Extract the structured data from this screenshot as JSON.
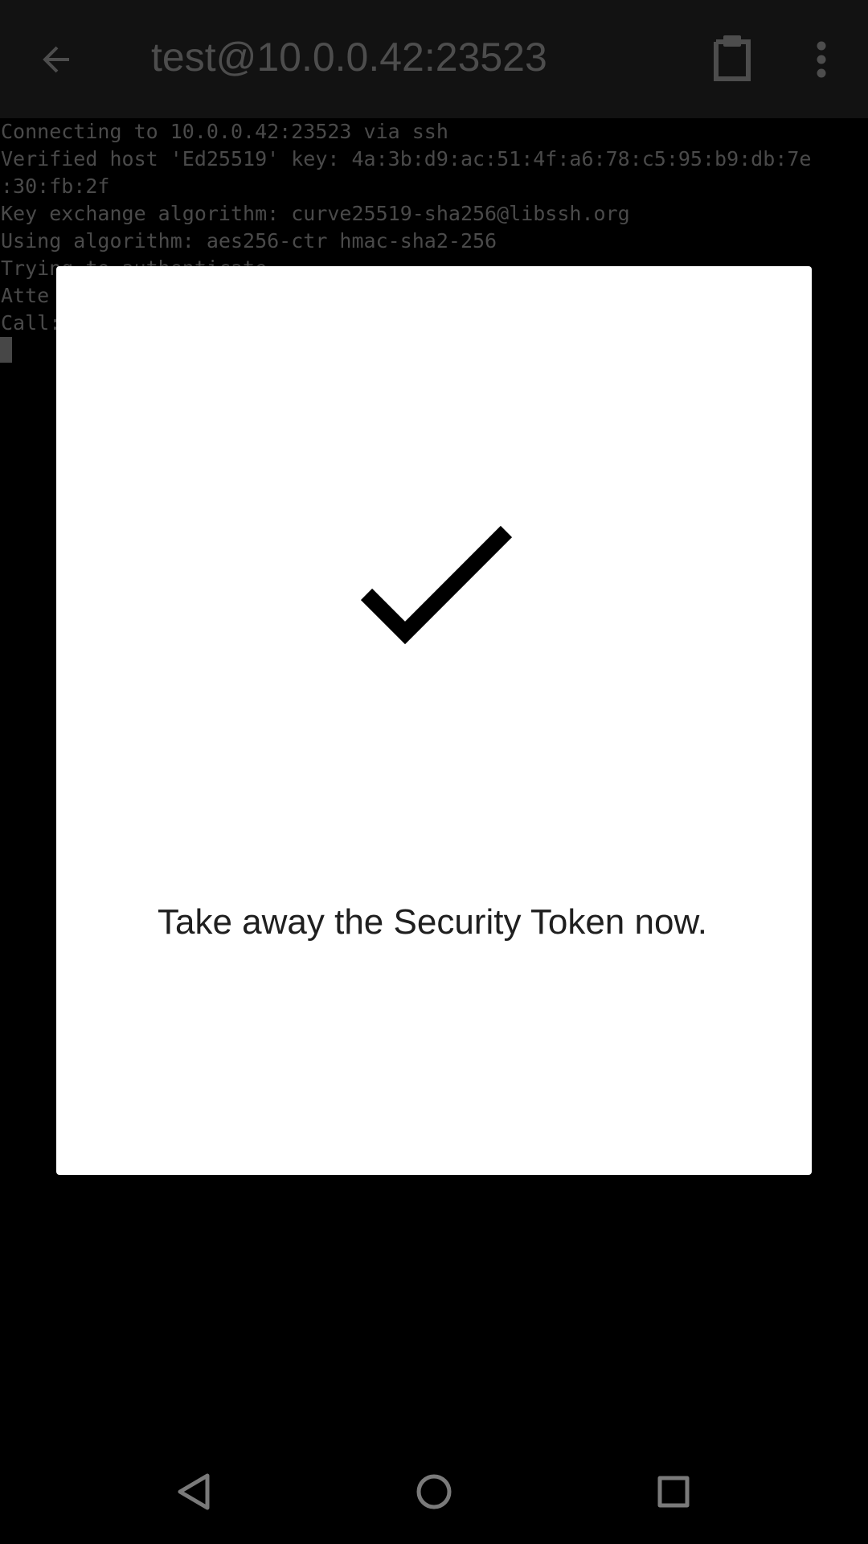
{
  "appbar": {
    "title": "test@10.0.0.42:23523",
    "back_icon": "arrow-back-icon",
    "clipboard_icon": "clipboard-icon",
    "menu_icon": "more-vert-icon"
  },
  "terminal": {
    "lines": [
      "Connecting to 10.0.0.42:23523 via ssh",
      "Verified host 'Ed25519' key: 4a:3b:d9:ac:51:4f:a6:78:c5:95:b9:db:7e",
      ":30:fb:2f",
      "Key exchange algorithm: curve25519-sha256@libssh.org",
      "Using algorithm: aes256-ctr hmac-sha2-256",
      "Trying to authenticate",
      "Atte",
      "Call:"
    ]
  },
  "dialog": {
    "icon": "checkmark-icon",
    "message": "Take away the Security Token now."
  },
  "navbar": {
    "back_icon": "nav-back-icon",
    "home_icon": "nav-home-icon",
    "recents_icon": "nav-recents-icon"
  },
  "colors": {
    "appbar_bg": "#121212",
    "terminal_bg": "#000000",
    "terminal_text": "#4a4a4a",
    "dialog_bg": "#ffffff",
    "dialog_text": "#1f1f1f"
  }
}
